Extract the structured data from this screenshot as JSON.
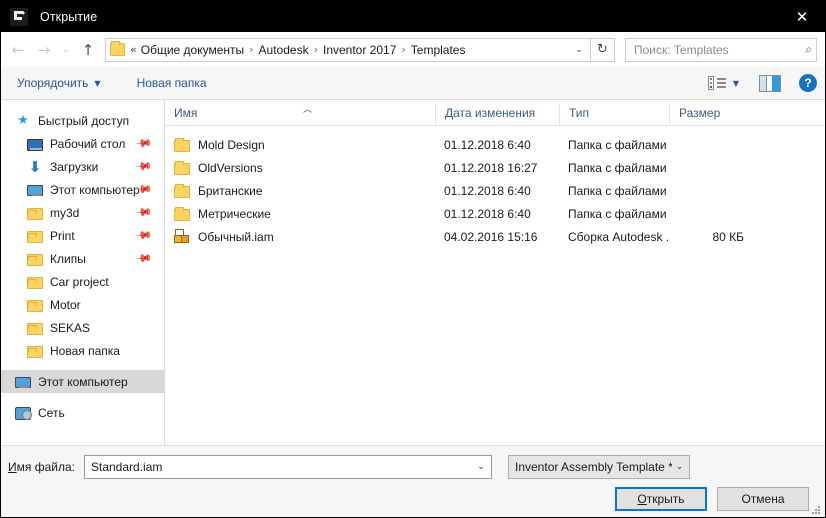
{
  "window": {
    "title": "Открытие",
    "app_icon": "inventor-icon",
    "close_label": "✕"
  },
  "addressbar": {
    "back_icon": "←",
    "forward_icon": "→",
    "recent_icon": "⌄",
    "up_icon": "↑",
    "separator_double": "«",
    "separator": "›",
    "crumbs": [
      "Общие документы",
      "Autodesk",
      "Inventor 2017",
      "Templates"
    ],
    "dropdown_icon": "⌄",
    "refresh_icon": "↻",
    "search_placeholder": "Поиск: Templates",
    "search_icon": "⌕"
  },
  "commandbar": {
    "organize_label": "Упорядочить",
    "organize_caret": "▼",
    "new_folder_label": "Новая папка",
    "view_caret": "▼",
    "help_label": "?"
  },
  "sidebar": {
    "quick_access": {
      "label": "Быстрый доступ",
      "icon": "star-icon"
    },
    "items": [
      {
        "label": "Рабочий стол",
        "icon": "desktop-icon",
        "pinned": true,
        "selected": false
      },
      {
        "label": "Загрузки",
        "icon": "download-icon",
        "pinned": true,
        "selected": false
      },
      {
        "label": "Этот компьютер",
        "icon": "pc-icon",
        "pinned": true,
        "selected": false
      },
      {
        "label": "my3d",
        "icon": "folder-icon",
        "pinned": true,
        "selected": false
      },
      {
        "label": "Print",
        "icon": "folder-icon",
        "pinned": true,
        "selected": false
      },
      {
        "label": "Клипы",
        "icon": "folder-icon",
        "pinned": true,
        "selected": false
      },
      {
        "label": "Car project",
        "icon": "folder-icon",
        "pinned": false,
        "selected": false
      },
      {
        "label": "Motor",
        "icon": "folder-icon",
        "pinned": false,
        "selected": false
      },
      {
        "label": "SEKAS",
        "icon": "folder-icon",
        "pinned": false,
        "selected": false
      },
      {
        "label": "Новая папка",
        "icon": "folder-icon",
        "pinned": false,
        "selected": false
      }
    ],
    "roots": [
      {
        "label": "Этот компьютер",
        "icon": "pc-icon",
        "selected": true
      },
      {
        "label": "Сеть",
        "icon": "network-icon",
        "selected": false
      }
    ],
    "pin_icon": "📌"
  },
  "filelist": {
    "sort_indicator": "︿",
    "columns": [
      {
        "key": "name",
        "label": "Имя"
      },
      {
        "key": "date",
        "label": "Дата изменения"
      },
      {
        "key": "type",
        "label": "Тип"
      },
      {
        "key": "size",
        "label": "Размер"
      }
    ],
    "rows": [
      {
        "name": "Mold Design",
        "date": "01.12.2018 6:40",
        "type": "Папка с файлами",
        "size": "",
        "icon": "folder-icon"
      },
      {
        "name": "OldVersions",
        "date": "01.12.2018 16:27",
        "type": "Папка с файлами",
        "size": "",
        "icon": "folder-icon"
      },
      {
        "name": "Британские",
        "date": "01.12.2018 6:40",
        "type": "Папка с файлами",
        "size": "",
        "icon": "folder-icon"
      },
      {
        "name": "Метрические",
        "date": "01.12.2018 6:40",
        "type": "Папка с файлами",
        "size": "",
        "icon": "folder-icon"
      },
      {
        "name": "Обычный.iam",
        "date": "04.02.2016 15:16",
        "type": "Сборка Autodesk ...",
        "size": "80 КБ",
        "icon": "assembly-icon"
      }
    ]
  },
  "bottom": {
    "filename_label": "Имя файла:",
    "filename_label_accel": "И",
    "filename_label_rest": "мя файла:",
    "filename_value": "Standard.iam",
    "filename_caret": "⌄",
    "filter_value": "Inventor Assembly Template *.i",
    "filter_caret": "⌄",
    "open_button": "Открыть",
    "open_accel": "О",
    "open_rest": "ткрыть",
    "cancel_button": "Отмена"
  },
  "colors": {
    "titlebar_bg": "#000000",
    "accent_blue": "#0078d7",
    "link_blue": "#2b5797",
    "column_header": "#3a5a8c",
    "folder_yellow": "#fcd462",
    "selection_gray": "#d8d8d8"
  }
}
